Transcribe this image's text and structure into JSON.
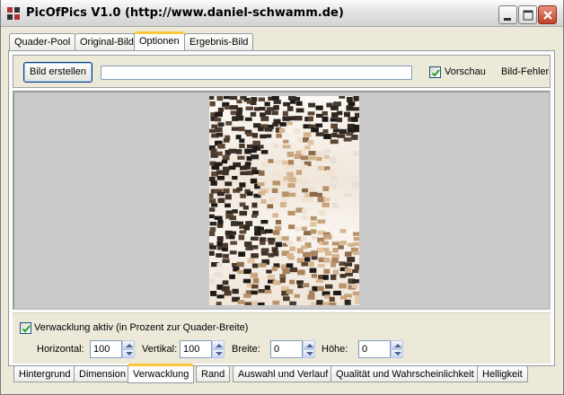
{
  "window": {
    "title": "PicOfPics V1.0 (http://www.daniel-schwamm.de)"
  },
  "top_tabs": [
    {
      "label": "Quader-Pool",
      "active": false
    },
    {
      "label": "Original-Bild",
      "active": false
    },
    {
      "label": "Optionen",
      "active": true
    },
    {
      "label": "Ergebnis-Bild",
      "active": false
    }
  ],
  "toolbar": {
    "create_button": "Bild erstellen",
    "path_value": "",
    "preview_checkbox": {
      "label": "Vorschau",
      "checked": true
    },
    "error_label": "Bild-Fehler-S"
  },
  "jitter": {
    "checkbox_label": "Verwacklung aktiv (in Prozent zur Quader-Breite)",
    "checked": true,
    "horizontal_label": "Horizontal:",
    "horizontal_value": "100",
    "vertical_label": "Vertikal:",
    "vertical_value": "100",
    "width_label": "Breite:",
    "width_value": "0",
    "height_label": "Höhe:",
    "height_value": "0"
  },
  "bottom_tabs": [
    {
      "label": "Hintergrund",
      "active": false
    },
    {
      "label": "Dimension",
      "active": false
    },
    {
      "label": "Verwacklung",
      "active": true
    },
    {
      "label": "Rand",
      "active": false
    },
    {
      "label": "Auswahl und Verlauf",
      "active": false
    },
    {
      "label": "Qualität und Wahrscheinlichkeit",
      "active": false
    },
    {
      "label": "Helligkeit",
      "active": false
    }
  ],
  "icons": {
    "app": "app-icon",
    "minimize": "minimize-icon",
    "maximize": "maximize-icon",
    "close": "close-icon",
    "check": "checkmark-icon",
    "spin_up": "spin-up-icon",
    "spin_down": "spin-down-icon"
  },
  "colors": {
    "window_bg": "#ece9d8",
    "tab_highlight": "#ffc83c",
    "close_button": "#c1412a",
    "checkmark": "#21a121"
  }
}
